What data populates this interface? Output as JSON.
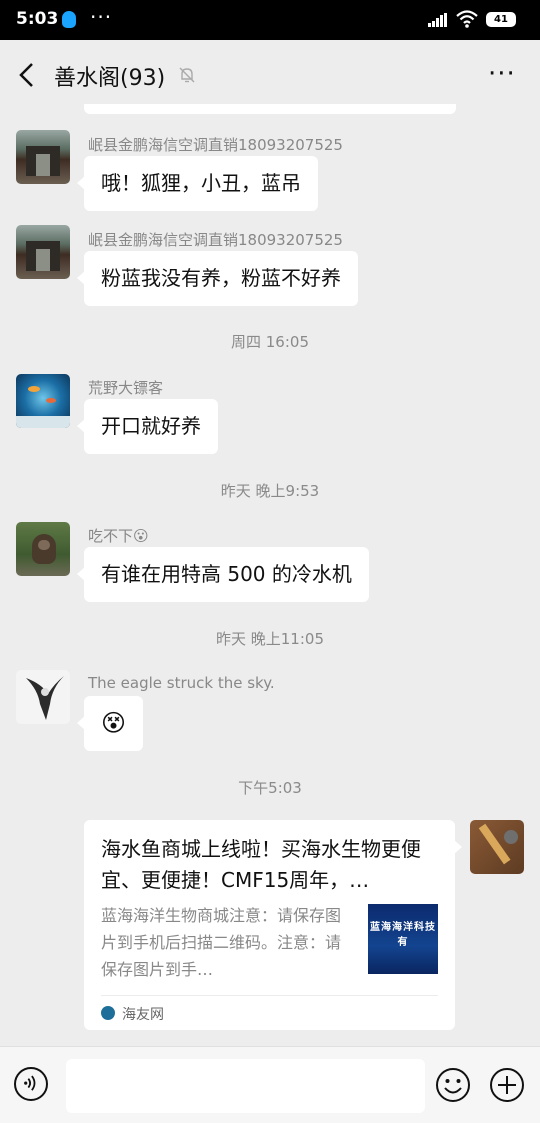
{
  "status_bar": {
    "time": "5:03",
    "more": "···",
    "battery": "41"
  },
  "header": {
    "title": "善水阁(93)",
    "more": "···"
  },
  "messages": [
    {
      "sender": "岷县金鹏海信空调直销18093207525",
      "text": "哦！狐狸，小丑，蓝吊"
    },
    {
      "sender": "岷县金鹏海信空调直销18093207525",
      "text": "粉蓝我没有养，粉蓝不好养"
    },
    {
      "timestamp": "周四 16:05"
    },
    {
      "sender": "荒野大镖客",
      "text": "开口就好养"
    },
    {
      "timestamp": "昨天 晚上9:53"
    },
    {
      "sender": "吃不下😮",
      "text": "有谁在用特高 500 的冷水机"
    },
    {
      "timestamp": "昨天 晚上11:05"
    },
    {
      "sender": "The eagle struck the sky.",
      "text": "😵"
    },
    {
      "timestamp": "下午5:03"
    }
  ],
  "link_card": {
    "title": "海水鱼商城上线啦！买海水生物更便宜、更便捷！CMF15周年，…",
    "description": "蓝海海洋生物商城注意：请保存图片到手机后扫描二维码。注意：请保存图片到手…",
    "thumb_text": "蓝海海洋科技有",
    "source": "海友网"
  },
  "input": {
    "placeholder": ""
  },
  "colors": {
    "background": "#ededed",
    "bubble": "#ffffff",
    "meta_text": "#888888"
  },
  "icons": [
    "qq-icon",
    "signal-icon",
    "wifi-icon",
    "battery-icon",
    "back-icon",
    "mute-bell-icon",
    "more-icon",
    "voice-icon",
    "emoji-icon",
    "plus-icon"
  ]
}
